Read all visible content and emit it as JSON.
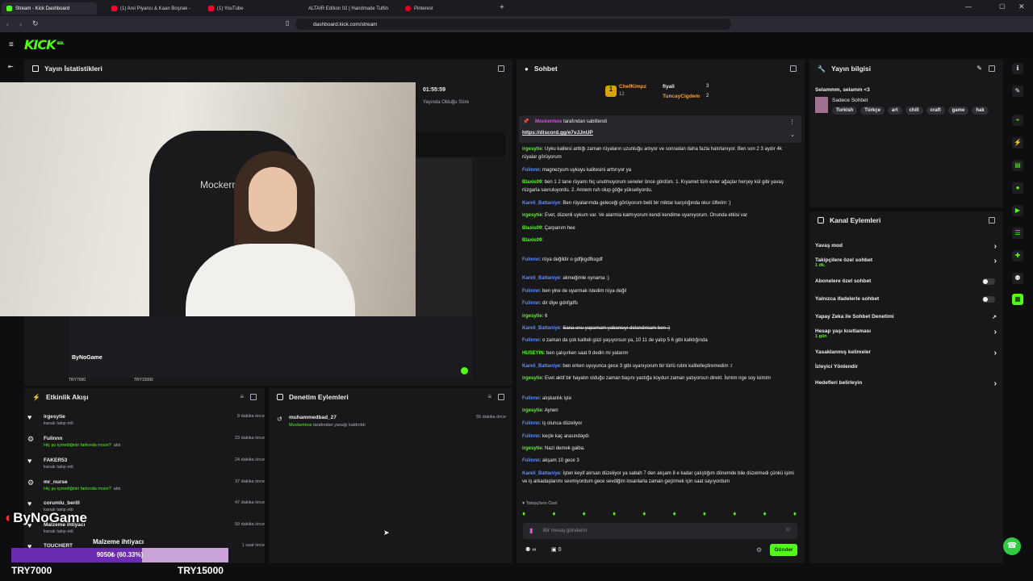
{
  "browser": {
    "tabs": [
      {
        "label": "Stream - Kick Dashboard",
        "active": true
      },
      {
        "label": "(1) Anıl Piyancı & Kaan Boşnak -",
        "active": false
      },
      {
        "label": "(1) YouTube",
        "active": false
      },
      {
        "label": "ALTAIR Edition 02 | Handmade Tuftin",
        "active": false
      },
      {
        "label": "Pinterest",
        "active": false
      }
    ],
    "url": "dashboard.kick.com/stream"
  },
  "kick": {
    "logo": "KICK",
    "logo_sup": "BETA",
    "accent": "#53fc18"
  },
  "stats": {
    "title": "Yayın İstatistikleri",
    "uptime": "01:55:59",
    "uptime_label": "Yayında Olduğu Süre"
  },
  "video": {
    "chair_text": "Mockerm",
    "overlay_brand": "ByNoGame",
    "goal_left": "TRY7000",
    "goal_right": "TRY15000"
  },
  "activity": {
    "title": "Etkinlik Akışı",
    "events": [
      {
        "name": "irgesytie",
        "detail": "kanalı takip etti",
        "time": "8 dakika önce",
        "icon": "heart-icon"
      },
      {
        "name": "Fulinnn",
        "detail": "Hiç şu içmediğinin farkında mısın?",
        "detail2": "aktı",
        "time": "23 dakika önce",
        "icon": "gift-icon"
      },
      {
        "name": "FAKER53",
        "detail": "kanalı takip etti",
        "time": "24 dakika önce",
        "icon": "heart-icon"
      },
      {
        "name": "mr_nurse",
        "detail": "Hiç şu içmediğinin farkında mısın?",
        "detail2": "aktı",
        "time": "37 dakika önce",
        "icon": "gift-icon"
      },
      {
        "name": "corumlu_berill",
        "detail": "kanalı takip etti",
        "time": "47 dakika önce",
        "icon": "heart-icon"
      },
      {
        "name": "Malzeme ihtiyacı",
        "detail": "kanalı takip etti",
        "time": "59 dakika önce",
        "icon": "heart-icon"
      },
      {
        "name": "TOUCHERT",
        "detail": "",
        "time": "1 saat önce",
        "icon": "heart-icon"
      }
    ]
  },
  "goal": {
    "label": "Malzeme ihtiyacı",
    "progress_text": "9050₺ (60.33%)",
    "progress": 0.6033,
    "left": "TRY7000",
    "right": "TRY15000"
  },
  "moderation": {
    "title": "Denetim Eylemleri",
    "entries": [
      {
        "user": "muhammedbad_27",
        "by": "Mockermos",
        "action": "tarafından yasağı kaldırıldı",
        "time": "55 dakika önce"
      }
    ]
  },
  "chat": {
    "title": "Sohbet",
    "top_gifters": [
      {
        "name": "ChefKimpz",
        "count": "12"
      },
      {
        "name": "fiyali",
        "count": "3"
      },
      {
        "name": "TuncayCigdem",
        "count": "2"
      }
    ],
    "pinned_by": "Mockermos",
    "pinned_label": "tarafından sabitlendi",
    "pinned_link": "https://discord.gg/e7vJJnUP",
    "messages": [
      {
        "user": "irgesytie",
        "cls": "u1",
        "text": "Uyku kalitesi arttığı zaman rüyaların uzunluğu artıyor ve sonradan daha fazla hatırlanıyor. Ben son 2 3 aydır 4k rüyalar görüyorum"
      },
      {
        "user": "Fulinnn",
        "cls": "u2",
        "text": "magnezyum uykuyu kalitesini arttırıyor ya"
      },
      {
        "user": "Blaxis09",
        "cls": "u1",
        "text": "ben 1 2 tane rüyamı hiç unutmuyorum seneler önce gördüm. 1. Kıyamet tüm evler ağaçlar herşey kül gibi yavaş rüzgarla savruluyordu. 2. Annem ruh olup göğe yükseliyordu."
      },
      {
        "user": "Kareli_Battaniye",
        "cls": "u2",
        "text": "Ben rüyalarımda geleceği görüyorum belli bir miktar karşılığında okur ülferim :)"
      },
      {
        "user": "irgesytie",
        "cls": "u1",
        "text": "Evet, düzenli uykum var. Ve alarmla kalmıyorum kendi kendime uyanıyorum. Onunda etkisi var"
      },
      {
        "user": "Blaxis09",
        "cls": "u1",
        "text": "Çarpanım hee"
      },
      {
        "user": "Blaxis09",
        "cls": "u1",
        "text": ""
      },
      {
        "user": "Fulinnn",
        "cls": "u2",
        "text": "rüya değildir o gdfjkgdfksgdf"
      },
      {
        "user": "Kareli_Battaniye",
        "cls": "u2",
        "text": "akmeğimle oynama :)"
      },
      {
        "user": "Fulinnn",
        "cls": "u2",
        "text": "ben yine de uyarmak istedim rüya değil"
      },
      {
        "user": "Fulinnn",
        "cls": "u2",
        "text": "dir diye gdnfgdfs"
      },
      {
        "user": "irgesytie",
        "cls": "u1",
        "text": "6"
      },
      {
        "user": "Kareli_Battaniye",
        "cls": "u2",
        "text": "Sana onu yapamam yabancıyı dolandırcam ben :)"
      },
      {
        "user": "Fulinnn",
        "cls": "u2",
        "text": "o zaman da çok kaliteli güzi yaşıyorsun ya, 10 11 de yatıp 5 6 gibi kalktığında"
      },
      {
        "user": "HUSEYIN",
        "cls": "u1",
        "text": "ben çalışırken saat 9 dedin mi yatarım"
      },
      {
        "user": "Kareli_Battaniye",
        "cls": "u2",
        "text": "ben erken uyuyunca gece 3 gibi uyanıyorum bir türlü rutini kalitelleştiremedim :/"
      },
      {
        "user": "irgesytie",
        "cls": "u1",
        "text": "Evet aktif bir hayatın olduğu zaman başını yastığa koydun zaman yatıyorsun direkt. İsmim irge soy isimim"
      },
      {
        "user": "Fulinnn",
        "cls": "u2",
        "text": "alışkanlık işte"
      },
      {
        "user": "irgesytie",
        "cls": "u1",
        "text": "Aynen"
      },
      {
        "user": "Fulinnn",
        "cls": "u2",
        "text": "iş olunca düzeliyor"
      },
      {
        "user": "Fulinnn",
        "cls": "u2",
        "text": "keçle kaç arasındaydı"
      },
      {
        "user": "irgesytie",
        "cls": "u1",
        "text": "Nazi demek gaiba."
      },
      {
        "user": "Fulinnn",
        "cls": "u2",
        "text": "akşam 10 gece 3"
      },
      {
        "user": "Kareli_Battaniye",
        "cls": "u2",
        "text": "İşten keyif alırsan düzeliyor ya sabah 7 den akşam 8 e kadar çalıştığım dönemde bile düzelmedi çünkü işimi ve iş arkadaşlarımı sevmiyordum gece sevdiğim insanlarla zaman geçirmek için saat sayıyordum"
      }
    ],
    "followers_only": "Takipçilere Özel",
    "input_placeholder": "Bir mesaj gönderin",
    "send_label": "Gönder",
    "viewers": "0",
    "chat_count": "∞"
  },
  "stream_info": {
    "title": "Yayın bilgisi",
    "stream_title": "Selammm, selamm <3",
    "category": "Sadece Sohbet",
    "tags": [
      "Turkish",
      "Türkçe",
      "art",
      "chill",
      "craft",
      "game",
      "hak"
    ]
  },
  "channel_actions": {
    "title": "Kanal Eylemleri",
    "items": [
      {
        "label": "Yavaş mod",
        "sub": "",
        "control": "chevron"
      },
      {
        "label": "Takipçilere özel sohbet",
        "sub": "1 dk.",
        "control": "chevron"
      },
      {
        "label": "Abonelere özel sohbet",
        "sub": "",
        "control": "toggle"
      },
      {
        "label": "Yalnızca ifadelerle sohbet",
        "sub": "",
        "control": "toggle"
      },
      {
        "label": "Yapay Zeka ile Sohbet Denetimi",
        "sub": "",
        "control": "external"
      },
      {
        "label": "Hesap yaşı kısıtlaması",
        "sub": "1 gün",
        "control": "chevron"
      },
      {
        "label": "Yasaklanmış kelimeler",
        "sub": "",
        "control": "chevron"
      },
      {
        "label": "İzleyici Yönlendir",
        "sub": "",
        "control": "none"
      },
      {
        "label": "Hedefleri belirleyin",
        "sub": "",
        "control": "chevron"
      }
    ]
  }
}
